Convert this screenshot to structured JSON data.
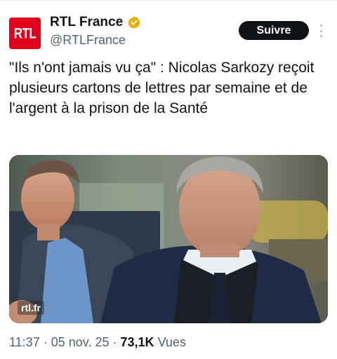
{
  "tweet": {
    "author": {
      "display_name": "RTL France",
      "handle": "@RTLFrance",
      "avatar_logo_text": "RTL",
      "verified": true,
      "verified_badge_color": "#e7b00b"
    },
    "follow_label": "Suivre",
    "text": "\"Ils n'ont jamais vu ça\" : Nicolas Sarkozy reçoit plusieurs cartons de lettres par semaine et de l'argent à la prison de la Santé",
    "media": {
      "watermark": "rtl.fr"
    },
    "meta": {
      "time": "11:37",
      "separator": "·",
      "date": "05 nov. 25",
      "views_count": "73,1K",
      "views_label": "Vues"
    }
  },
  "colors": {
    "brand_red": "#e2001a",
    "text_primary": "#0f1419",
    "text_secondary": "#536471",
    "button_bg": "#0f1419"
  },
  "icons": [
    "verified-badge-icon",
    "more-options-icon"
  ]
}
